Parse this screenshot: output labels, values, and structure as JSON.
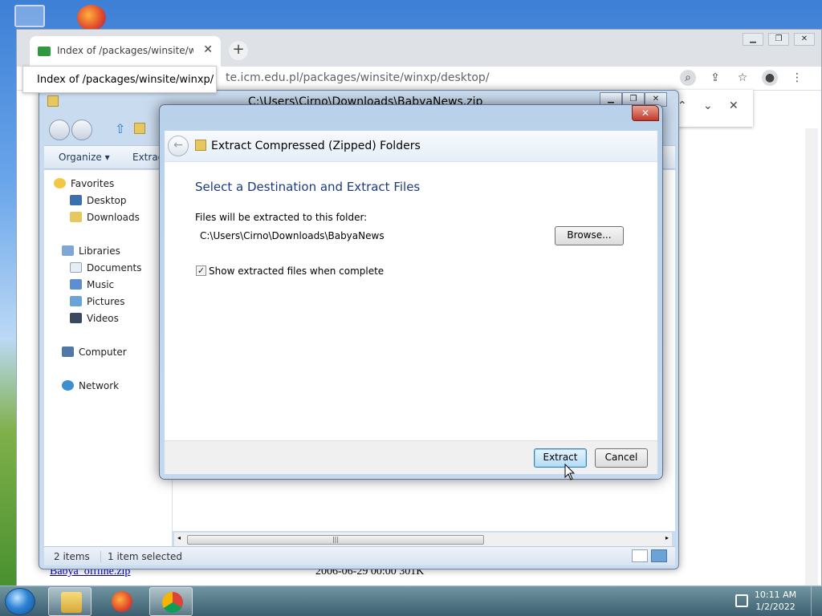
{
  "browser": {
    "tab_title": "Index of /packages/winsite/winxp",
    "tooltip": "Index of /packages/winsite/winxp/",
    "url": "te.icm.edu.pl/packages/winsite/winxp/desktop/",
    "page_file_link": "Babya_offline.zip",
    "page_file_meta": "2006-06-29 00:00 301K"
  },
  "explorer": {
    "title": "C:\\Users\\Cirno\\Downloads\\BabyaNews.zip",
    "organize": "Organize ▾",
    "extract_cmd": "Extract",
    "nav": {
      "favorites": "Favorites",
      "desktop": "Desktop",
      "downloads": "Downloads",
      "libraries": "Libraries",
      "documents": "Documents",
      "music": "Music",
      "pictures": "Pictures",
      "videos": "Videos",
      "computer": "Computer",
      "network": "Network"
    },
    "status_items": "2 items",
    "status_selected": "1 item selected"
  },
  "dialog": {
    "header_title": "Extract Compressed (Zipped) Folders",
    "heading": "Select a Destination and Extract Files",
    "dest_label": "Files will be extracted to this folder:",
    "dest_path": "C:\\Users\\Cirno\\Downloads\\BabyaNews",
    "browse_label": "Browse...",
    "show_files_label": "Show extracted files when complete",
    "show_files_checked": true,
    "extract_label": "Extract",
    "cancel_label": "Cancel"
  },
  "taskbar": {
    "time": "10:11 AM",
    "date": "1/2/2022"
  }
}
